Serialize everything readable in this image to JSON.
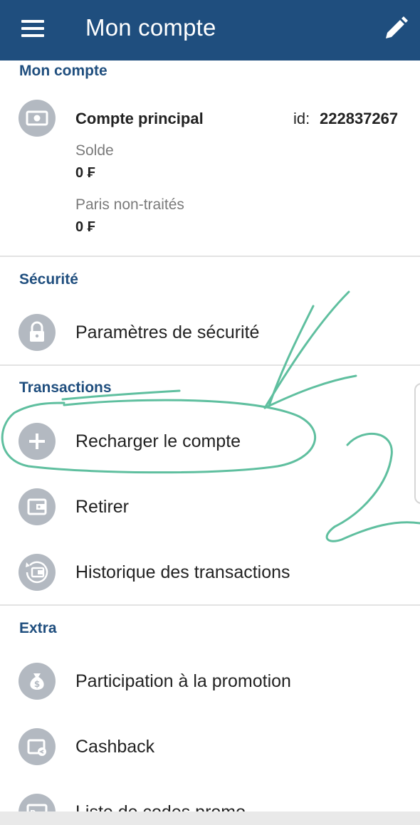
{
  "header": {
    "title": "Mon compte",
    "menu_icon": "hamburger-menu-icon",
    "edit_icon": "pencil-icon"
  },
  "account_section": {
    "title": "Mon compte",
    "name": "Compte principal",
    "id_label": "id:",
    "id_value": "222837267",
    "balance_label": "Solde",
    "balance_value": "0 ₣",
    "unsettled_label": "Paris non-traités",
    "unsettled_value": "0 ₣"
  },
  "security_section": {
    "title": "Sécurité",
    "items": [
      {
        "label": "Paramètres de sécurité",
        "icon": "lock-icon"
      }
    ]
  },
  "transactions_section": {
    "title": "Transactions",
    "items": [
      {
        "label": "Recharger le compte",
        "icon": "plus-icon"
      },
      {
        "label": "Retirer",
        "icon": "wallet-icon"
      },
      {
        "label": "Historique des transactions",
        "icon": "history-icon"
      }
    ]
  },
  "extra_section": {
    "title": "Extra",
    "items": [
      {
        "label": "Participation à la promotion",
        "icon": "money-bag-icon"
      },
      {
        "label": "Cashback",
        "icon": "cashback-icon"
      },
      {
        "label": "Liste de codes promo",
        "icon": "promo-code-icon"
      }
    ]
  },
  "colors": {
    "header_bg": "#1f4e7e",
    "section_title": "#1f4e7e",
    "icon_bg": "#b3b9c1",
    "annotation": "#5fbf9f"
  }
}
